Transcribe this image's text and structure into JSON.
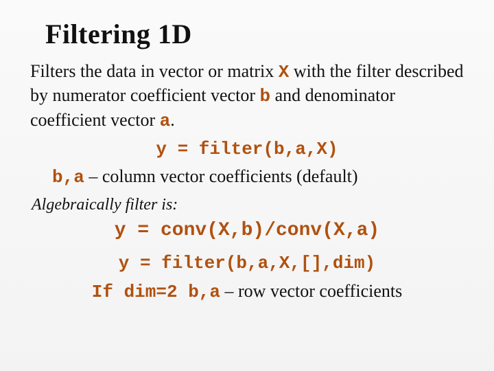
{
  "title": "Filtering 1D",
  "line1a": "Filters the data in vector or matrix ",
  "line1_X": "X",
  "line1b": " with the filter described by numerator coefficient vector ",
  "line1_b": "b",
  "line1c": " and denominator coefficient vector ",
  "line1_a": "a",
  "line1d": ".",
  "eq1": "y = filter(b,a,X)",
  "ba_label": "b,a",
  "ba_desc": " – column vector coefficients (default)",
  "alg_label": "Algebraically filter is:",
  "eq2": "y = conv(X,b)/conv(X,a)",
  "eq3": "y = filter(b,a,X,[],dim)",
  "if_label": "If ",
  "dim_expr": "dim=2 b,a",
  "row_desc": " – row vector coefficients"
}
